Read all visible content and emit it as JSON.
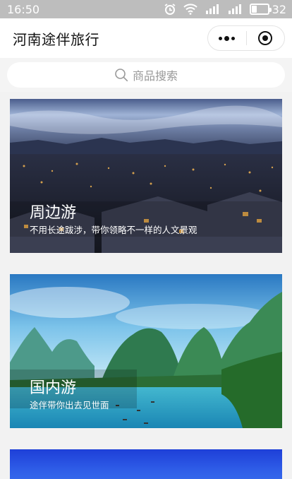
{
  "status_bar": {
    "time": "16:50",
    "battery": "32",
    "battery_level": 0.32
  },
  "nav": {
    "title": "河南途伴旅行"
  },
  "search": {
    "placeholder": "商品搜索"
  },
  "cards": [
    {
      "title": "周边游",
      "subtitle": "不用长途跋涉，带你领略不一样的人文景观"
    },
    {
      "title": "国内游",
      "subtitle": "途伴带你出去见世面"
    }
  ]
}
